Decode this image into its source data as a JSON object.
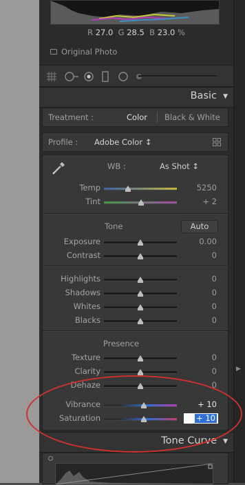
{
  "histogram": {
    "r_label": "R",
    "r_value": "27.0",
    "g_label": "G",
    "g_value": "28.5",
    "b_label": "B",
    "b_value": "23.0",
    "unit": "%"
  },
  "original_photo": "Original Photo",
  "basic": {
    "title": "Basic",
    "treatment_label": "Treatment :",
    "treatment_color": "Color",
    "treatment_bw": "Black & White",
    "profile_label": "Profile :",
    "profile_value": "Adobe Color ↕",
    "wb_label": "WB :",
    "wb_value": "As Shot ↕",
    "temp": {
      "label": "Temp",
      "value": "5250",
      "level": 0.33
    },
    "tint": {
      "label": "Tint",
      "value": "+ 2",
      "level": 0.51
    },
    "tone_label": "Tone",
    "auto_label": "Auto",
    "tone_sliders": [
      {
        "label": "Exposure",
        "value": "0.00",
        "level": 0.5
      },
      {
        "label": "Contrast",
        "value": "0",
        "level": 0.5
      }
    ],
    "tone_sliders2": [
      {
        "label": "Highlights",
        "value": "0",
        "level": 0.5
      },
      {
        "label": "Shadows",
        "value": "0",
        "level": 0.5
      },
      {
        "label": "Whites",
        "value": "0",
        "level": 0.5
      },
      {
        "label": "Blacks",
        "value": "0",
        "level": 0.5
      }
    ],
    "presence_label": "Presence",
    "presence_sliders": [
      {
        "label": "Texture",
        "value": "0",
        "level": 0.5
      },
      {
        "label": "Clarity",
        "value": "0",
        "level": 0.5
      },
      {
        "label": "Dehaze",
        "value": "0",
        "level": 0.5
      }
    ],
    "vibrance": {
      "label": "Vibrance",
      "value": "+ 10",
      "level": 0.55
    },
    "saturation": {
      "label": "Saturation",
      "value": "+ 10",
      "level": 0.55
    }
  },
  "tone_curve": {
    "title": "Tone Curve"
  },
  "colors": {
    "annotation_circle": "#d0312f",
    "selection": "#2f6fd6"
  }
}
